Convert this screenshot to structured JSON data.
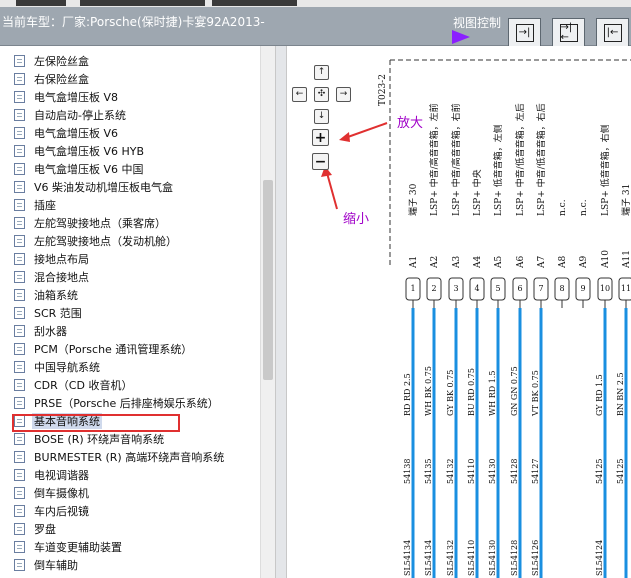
{
  "header": {
    "title": "当前车型：厂家:Porsche(保时捷)卡宴92A2013-",
    "view_control": "视图控制",
    "view_buttons": [
      {
        "glyph": "→|"
      },
      {
        "glyph": "→|←"
      },
      {
        "glyph": "|←"
      }
    ]
  },
  "tree": {
    "items": [
      {
        "label": "左保险丝盒"
      },
      {
        "label": "右保险丝盒"
      },
      {
        "label": "电气盒增压板 V8"
      },
      {
        "label": "自动启动-停止系统"
      },
      {
        "label": "电气盒增压板 V6"
      },
      {
        "label": "电气盒增压板 V6 HYB"
      },
      {
        "label": "电气盒增压板 V6 中国"
      },
      {
        "label": "V6 柴油发动机增压板电气盒"
      },
      {
        "label": "插座"
      },
      {
        "label": "左舵驾驶接地点（乘客席）"
      },
      {
        "label": "左舵驾驶接地点（发动机舱）"
      },
      {
        "label": "接地点布局"
      },
      {
        "label": "混合接地点"
      },
      {
        "label": "油箱系统"
      },
      {
        "label": "SCR 范围"
      },
      {
        "label": "刮水器"
      },
      {
        "label": "PCM（Porsche 通讯管理系统）"
      },
      {
        "label": "中国导航系统"
      },
      {
        "label": "CDR（CD 收音机）"
      },
      {
        "label": "PRSE（Porsche 后排座椅娱乐系统）"
      },
      {
        "label": "基本音响系统",
        "selected": true
      },
      {
        "label": "BOSE (R) 环绕声音响系统"
      },
      {
        "label": "BURMESTER (R) 高端环绕声音响系统"
      },
      {
        "label": "电视调谐器"
      },
      {
        "label": "倒车摄像机"
      },
      {
        "label": "车内后视镜"
      },
      {
        "label": "罗盘"
      },
      {
        "label": "车道变更辅助装置"
      },
      {
        "label": "倒车辅助"
      }
    ]
  },
  "diagram": {
    "nav": {
      "up": "↑",
      "down": "↓",
      "left": "←",
      "right": "→",
      "center": "✣"
    },
    "zoom_in": "+",
    "zoom_out": "−",
    "zoom_in_label": "放大",
    "zoom_out_label": "缩小",
    "connector_label": "T023-2",
    "pins": [
      {
        "id": "A1",
        "desc": "端子 30",
        "num": "1",
        "wire": "RD RD 2.5",
        "circuit": "54138",
        "bottom": "SL54134"
      },
      {
        "id": "A2",
        "desc": "LSP+ 中音/高音音箱，左前",
        "num": "2",
        "wire": "WH BK 0.75",
        "circuit": "54135",
        "bottom": "SL54134"
      },
      {
        "id": "A3",
        "desc": "LSP+ 中音/高音音箱，右前",
        "num": "3",
        "wire": "GY BK 0.75",
        "circuit": "54132",
        "bottom": "SL54132"
      },
      {
        "id": "A4",
        "desc": "LSP+ 中央",
        "num": "4",
        "wire": "BU RD 0.75",
        "circuit": "54110",
        "bottom": "SL54110"
      },
      {
        "id": "A5",
        "desc": "LSP+ 低音音箱，左侧",
        "num": "5",
        "wire": "WH RD 1.5",
        "circuit": "54130",
        "bottom": "SL54130"
      },
      {
        "id": "A6",
        "desc": "LSP+ 中音/低音音箱，左后",
        "num": "6",
        "wire": "GN GN 0.75",
        "circuit": "54128",
        "bottom": "SL54128"
      },
      {
        "id": "A7",
        "desc": "LSP+ 中音/低音音箱，右后",
        "num": "7",
        "wire": "VT BK 0.75",
        "circuit": "54127",
        "bottom": "SL54126"
      },
      {
        "id": "A8",
        "desc": "n.c.",
        "num": "8",
        "wire": "",
        "circuit": "",
        "bottom": ""
      },
      {
        "id": "A9",
        "desc": "n.c.",
        "num": "9",
        "wire": "",
        "circuit": "",
        "bottom": ""
      },
      {
        "id": "A10",
        "desc": "LSP+ 低音音箱，右侧",
        "num": "10",
        "wire": "GY RD 1.5",
        "circuit": "54125",
        "bottom": "SL54124"
      },
      {
        "id": "A11",
        "desc": "端子 31",
        "num": "11",
        "wire": "BN BN 2.5",
        "circuit": "54125",
        "bottom": ""
      }
    ],
    "colors": {
      "wire": "#1a8fe0",
      "annotation": "#e03030",
      "zoom_label": "#a000c8"
    }
  }
}
